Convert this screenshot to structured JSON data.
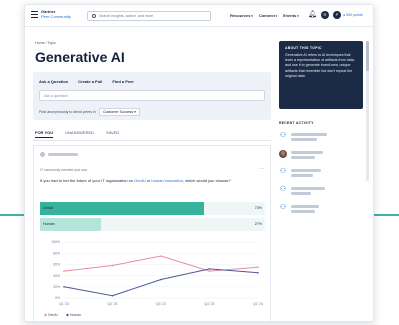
{
  "nav": {
    "logo_line1": "Gartner",
    "logo_line2": "Peer Community",
    "search_placeholder": "Search insights, advice, and more",
    "links": [
      "Resources",
      "Connect",
      "Events"
    ],
    "avatar_initials": [
      "R",
      "P"
    ],
    "points": "350 points"
  },
  "breadcrumb": "Home  /  Topic",
  "page_title": "Generative AI",
  "ask": {
    "tabs": [
      "Ask a Question",
      "Create a Poll",
      "Find a Peer"
    ],
    "input_placeholder": "Ask a question",
    "post_line": "Post anonymously to direct peers in",
    "post_target": "Customer Success"
  },
  "feed_tabs": [
    "FOR YOU",
    "UNANSWERED",
    "SAVED"
  ],
  "poll": {
    "meta": "IT community member just now",
    "question_before": "If you had to bet the future of your IT organization on ",
    "option_a": "GenAI",
    "question_mid": " or ",
    "option_b": "human innovation",
    "question_after": ", which would you choose?",
    "results": [
      {
        "label": "GenAI",
        "percent_text": "73%",
        "fraction": 0.73
      },
      {
        "label": "Human",
        "percent_text": "27%",
        "fraction": 0.27
      }
    ]
  },
  "about": {
    "heading": "ABOUT THIS TOPIC",
    "text": "Generative AI refers to AI techniques that learn a representation of artifacts from data, and use it to generate brand-new, unique artifacts that resemble but don't repeat the original data."
  },
  "recent_heading": "RECENT ACTIVITY",
  "colors": {
    "accent_teal": "#3fb3a8",
    "navy": "#1c2b45",
    "link_blue": "#2b6fd6",
    "genai_line": "#e88aa7",
    "human_line": "#4a5a9a"
  },
  "chart_data": {
    "type": "line",
    "x": [
      "Q1 '23",
      "Q2 '23",
      "Q3 '23",
      "Q4 '23",
      "Q1 '24"
    ],
    "ylim": [
      0,
      100
    ],
    "yticks": [
      "100%",
      "80%",
      "60%",
      "40%",
      "20%",
      "0%"
    ],
    "series": [
      {
        "name": "GenAI",
        "values": [
          48,
          58,
          75,
          48,
          55
        ]
      },
      {
        "name": "Human",
        "values": [
          20,
          4,
          33,
          52,
          45
        ]
      }
    ],
    "legend": "bottom-left",
    "grid": true
  }
}
